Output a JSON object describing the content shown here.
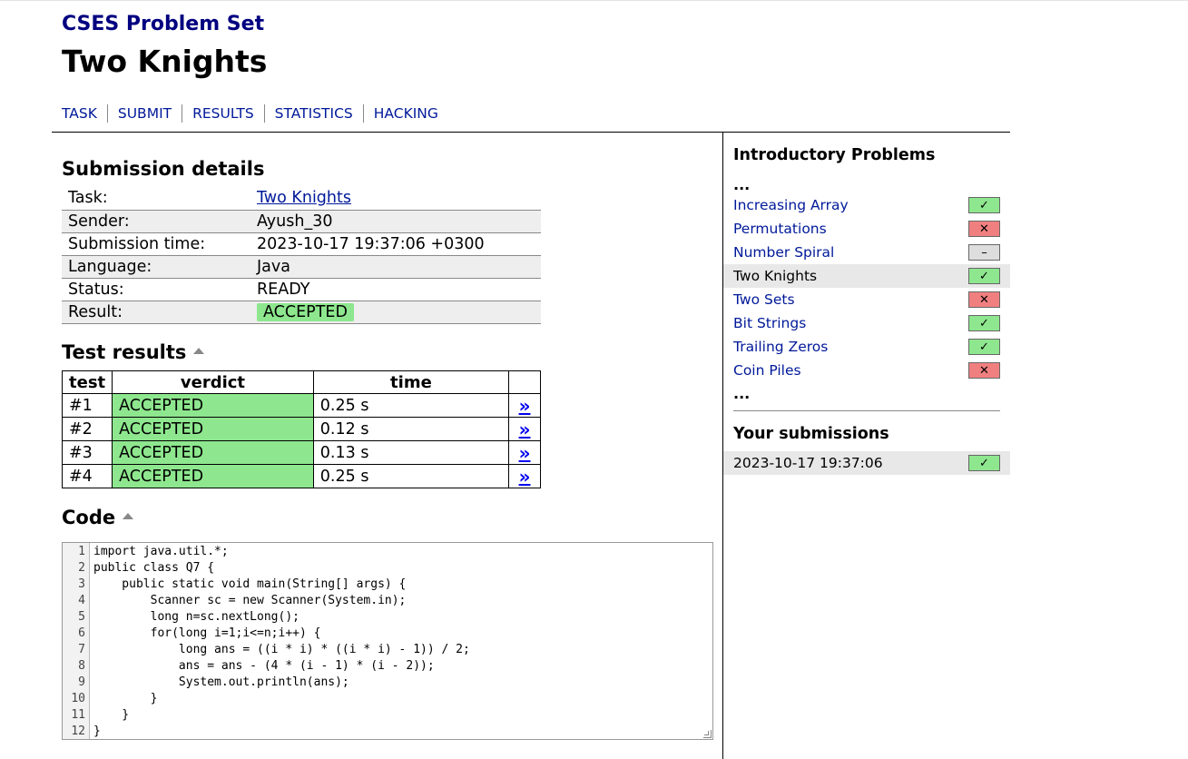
{
  "site_title": "CSES Problem Set",
  "task_title": "Two Knights",
  "nav": [
    "TASK",
    "SUBMIT",
    "RESULTS",
    "STATISTICS",
    "HACKING"
  ],
  "submission": {
    "heading": "Submission details",
    "rows": [
      {
        "label": "Task:",
        "value": "Two Knights"
      },
      {
        "label": "Sender:",
        "value": "Ayush_30"
      },
      {
        "label": "Submission time:",
        "value": "2023-10-17 19:37:06 +0300"
      },
      {
        "label": "Language:",
        "value": "Java"
      },
      {
        "label": "Status:",
        "value": "READY"
      },
      {
        "label": "Result:",
        "value": "ACCEPTED"
      }
    ]
  },
  "tests": {
    "heading": "Test results",
    "columns": [
      "test",
      "verdict",
      "time"
    ],
    "rows": [
      {
        "test": "#1",
        "verdict": "ACCEPTED",
        "time": "0.25 s",
        "link": "»"
      },
      {
        "test": "#2",
        "verdict": "ACCEPTED",
        "time": "0.12 s",
        "link": "»"
      },
      {
        "test": "#3",
        "verdict": "ACCEPTED",
        "time": "0.13 s",
        "link": "»"
      },
      {
        "test": "#4",
        "verdict": "ACCEPTED",
        "time": "0.25 s",
        "link": "»"
      }
    ]
  },
  "code": {
    "heading": "Code",
    "line_numbers": [
      "1",
      "2",
      "3",
      "4",
      "5",
      "6",
      "7",
      "8",
      "9",
      "10",
      "11",
      "12"
    ],
    "lines": [
      "import java.util.*;",
      "public class Q7 {",
      "    public static void main(String[] args) {",
      "        Scanner sc = new Scanner(System.in);",
      "        long n=sc.nextLong();",
      "        for(long i=1;i<=n;i++) {",
      "            long ans = ((i * i) * ((i * i) - 1)) / 2;",
      "            ans = ans - (4 * (i - 1) * (i - 2));",
      "            System.out.println(ans);",
      "        }",
      "    }",
      "}"
    ]
  },
  "sidebar": {
    "heading": "Introductory Problems",
    "ellipsis": "...",
    "problems": [
      {
        "name": "Increasing Array",
        "status": "ok",
        "icon": "✓"
      },
      {
        "name": "Permutations",
        "status": "fail",
        "icon": "✕"
      },
      {
        "name": "Number Spiral",
        "status": "none",
        "icon": "–"
      },
      {
        "name": "Two Knights",
        "status": "ok",
        "icon": "✓"
      },
      {
        "name": "Two Sets",
        "status": "fail",
        "icon": "✕"
      },
      {
        "name": "Bit Strings",
        "status": "ok",
        "icon": "✓"
      },
      {
        "name": "Trailing Zeros",
        "status": "ok",
        "icon": "✓"
      },
      {
        "name": "Coin Piles",
        "status": "fail",
        "icon": "✕"
      }
    ],
    "submissions_heading": "Your submissions",
    "submissions": [
      {
        "time": "2023-10-17 19:37:06",
        "status": "ok",
        "icon": "✓"
      }
    ]
  },
  "colors": {
    "accepted": "#8ee78e",
    "failed": "#f08080",
    "link": "#001999",
    "site_title": "#000080"
  }
}
